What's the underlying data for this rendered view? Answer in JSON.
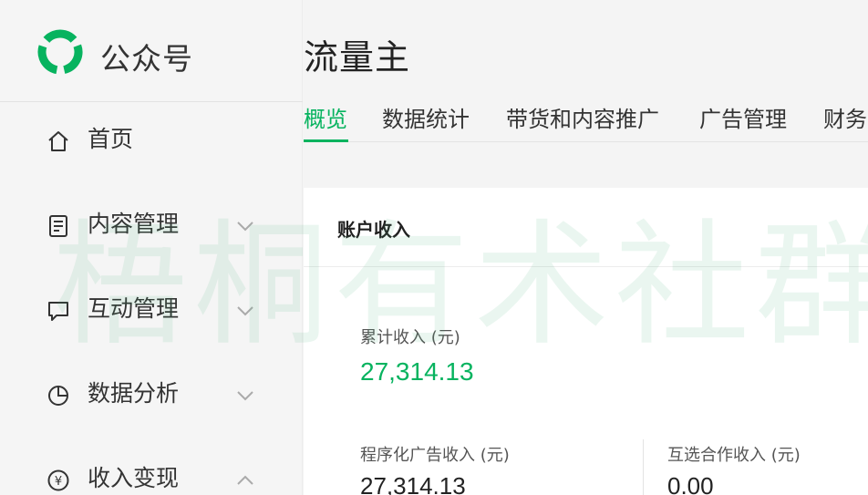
{
  "brand": {
    "name": "公众号",
    "logo_icon": "wechat-official-account-logo",
    "accent": "#07b35f"
  },
  "sidebar": {
    "items": [
      {
        "label": "首页",
        "icon": "home-icon",
        "chevron": ""
      },
      {
        "label": "内容管理",
        "icon": "document-icon",
        "chevron": "chevron-down-icon"
      },
      {
        "label": "互动管理",
        "icon": "chat-bubble-icon",
        "chevron": "chevron-down-icon"
      },
      {
        "label": "数据分析",
        "icon": "pie-chart-icon",
        "chevron": "chevron-down-icon"
      },
      {
        "label": "收入变现",
        "icon": "yuan-circle-icon",
        "chevron": "chevron-up-icon"
      }
    ]
  },
  "header": {
    "title": "流量主"
  },
  "tabs": [
    {
      "label": "概览",
      "active": true
    },
    {
      "label": "数据统计",
      "active": false
    },
    {
      "label": "带货和内容推广",
      "active": false
    },
    {
      "label": "广告管理",
      "active": false
    },
    {
      "label": "财务",
      "active": false
    }
  ],
  "account": {
    "title": "账户收入",
    "total": {
      "label": "累计收入 (元)",
      "value": "27,314.13"
    },
    "programmatic": {
      "label": "程序化广告收入 (元)",
      "value": "27,314.13"
    },
    "mutual": {
      "label": "互选合作收入 (元)",
      "value": "0.00"
    }
  },
  "watermark": "梧桐有术社群"
}
